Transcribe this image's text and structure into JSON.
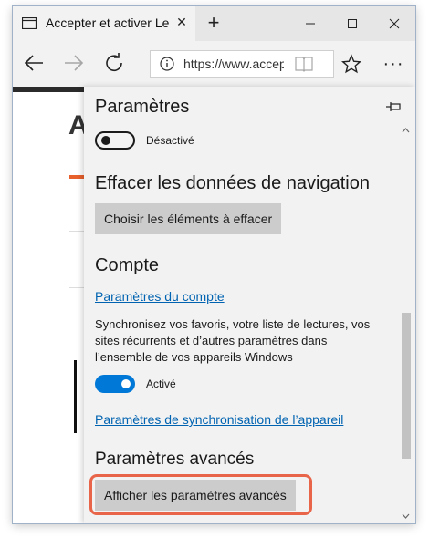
{
  "tab": {
    "title": "Accepter et activer Les Cookies"
  },
  "addressbar": {
    "url": "https://www.accepter-cookies.com"
  },
  "page": {
    "visible_letter": "A"
  },
  "settings": {
    "title": "Paramètres",
    "top_toggle": {
      "label": "Désactivé",
      "state": "off"
    },
    "clear_data": {
      "heading": "Effacer les données de navigation",
      "button": "Choisir les éléments à effacer"
    },
    "account": {
      "heading": "Compte",
      "link": "Paramètres du compte",
      "description": "Synchronisez vos favoris, votre liste de lectures, vos sites récurrents et d’autres paramètres dans l’ensemble de vos appareils Windows",
      "sync_toggle": {
        "label": "Activé",
        "state": "on"
      },
      "sync_link": "Paramètres de synchronisation de l’appareil"
    },
    "advanced": {
      "heading": "Paramètres avancés",
      "button": "Afficher les paramètres avancés"
    }
  },
  "colors": {
    "accent": "#0078d7",
    "link": "#0063b1",
    "highlight": "#e8654a",
    "panel_bg": "#f2f2f2",
    "button_bg": "#cccccc"
  }
}
